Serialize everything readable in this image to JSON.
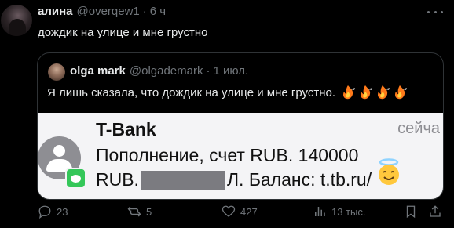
{
  "tweet": {
    "author_name": "алина",
    "author_handle": "@overqew1",
    "separator": "·",
    "time": "6 ч",
    "text": "дождик на улице и мне грустно"
  },
  "quote": {
    "author_name": "olga mark",
    "author_handle": "@olgademark",
    "separator": "·",
    "time": "1 июл.",
    "text": "Я лишь сказала, что дождик на улице и мне грустно.",
    "emoji": "fire-icon"
  },
  "notification": {
    "app_name": "T-Bank",
    "time": "сейча",
    "line1": "Пополнение, счет RUB. 140000",
    "line2_prefix": "RUB.",
    "line2_suffix": "Л. Баланс: t.tb.ru/"
  },
  "actions": {
    "replies": "23",
    "retweets": "5",
    "likes": "427",
    "views": "13 тыс."
  },
  "colors": {
    "background": "#000000",
    "text_primary": "#e7e9ea",
    "text_secondary": "#71767b",
    "border": "#2f3336",
    "notification_bg": "#f4f4f6",
    "message_green": "#34c759"
  }
}
